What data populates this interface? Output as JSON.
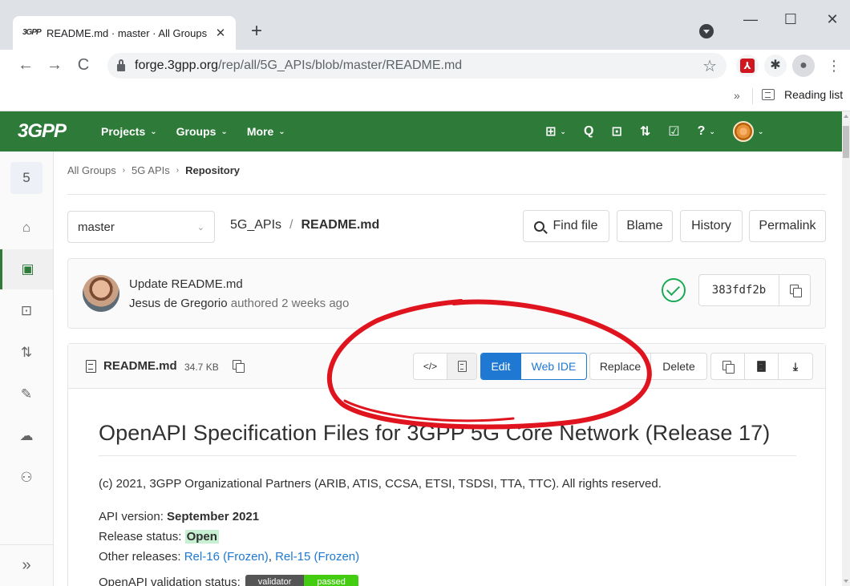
{
  "browser": {
    "tab_title": "README.md · master · All Groups",
    "favicon_text": "3GPP",
    "new_tab": "+",
    "tab_close": "✕",
    "url_host": "forge.3gpp.org",
    "url_path": "/rep/all/5G_APIs/blob/master/README.md",
    "back": "←",
    "forward": "→",
    "reload": "C",
    "star": "☆",
    "window_minimize": "—",
    "window_maximize": "☐",
    "window_close": "✕",
    "pdf_ext": "⅄",
    "puzzle_ext": "✱",
    "profile": "●",
    "menu": "⋮",
    "bookmarks_more": "»",
    "reading_list": "Reading list"
  },
  "gitlab_header": {
    "logo_text": "3GPP",
    "nav": [
      {
        "label": "Projects"
      },
      {
        "label": "Groups"
      },
      {
        "label": "More"
      }
    ],
    "chevron": "⌄",
    "right_icons": {
      "plus": "⊞",
      "search": "Q",
      "issues": "⊡",
      "merge_requests": "⇅",
      "todos": "☑",
      "help": "?"
    }
  },
  "sidebar": {
    "project_avatar": "5",
    "items": [
      {
        "name": "home",
        "glyph": "⌂"
      },
      {
        "name": "repository",
        "glyph": "▣"
      },
      {
        "name": "issues",
        "glyph": "⊡"
      },
      {
        "name": "merge-requests",
        "glyph": "⇅"
      },
      {
        "name": "ci-cd",
        "glyph": "✎"
      },
      {
        "name": "operations",
        "glyph": "☁"
      },
      {
        "name": "members",
        "glyph": "⚇"
      }
    ],
    "collapse": "»"
  },
  "breadcrumb": {
    "items": [
      "All Groups",
      "5G APIs",
      "Repository"
    ],
    "separator": "›"
  },
  "file_nav": {
    "branch": "master",
    "branch_chevron": "⌄",
    "project": "5G_APIs",
    "separator": "/",
    "file": "README.md",
    "buttons": {
      "find_file": "Find file",
      "blame": "Blame",
      "history": "History",
      "permalink": "Permalink"
    }
  },
  "commit": {
    "message": "Update README.md",
    "author": "Jesus de Gregorio",
    "authored_text": "authored 2 weeks ago",
    "sha": "383fdf2b",
    "status": "success"
  },
  "file_header": {
    "name": "README.md",
    "size": "34.7 KB",
    "source_toggle": "</>",
    "edit": "Edit",
    "web_ide": "Web IDE",
    "replace": "Replace",
    "delete": "Delete",
    "download": "⤓"
  },
  "readme": {
    "title": "OpenAPI Specification Files for 3GPP 5G Core Network (Release 17)",
    "copyright": "(c) 2021, 3GPP Organizational Partners (ARIB, ATIS, CCSA, ETSI, TSDSI, TTA, TTC). All rights reserved.",
    "api_version_label": "API version: ",
    "api_version_value": "September 2021",
    "release_status_label": "Release status: ",
    "release_status_value": "Open",
    "other_releases_label": "Other releases: ",
    "rel16": "Rel-16 (Frozen)",
    "rel_sep": ", ",
    "rel15": "Rel-15 (Frozen)",
    "validation_label": "OpenAPI validation status:",
    "badge_left": "validator",
    "badge_right": "passed"
  },
  "colors": {
    "gitlab_green": "#2d7a39",
    "link_blue": "#1f78d1",
    "annotation_red": "#e0141e"
  }
}
